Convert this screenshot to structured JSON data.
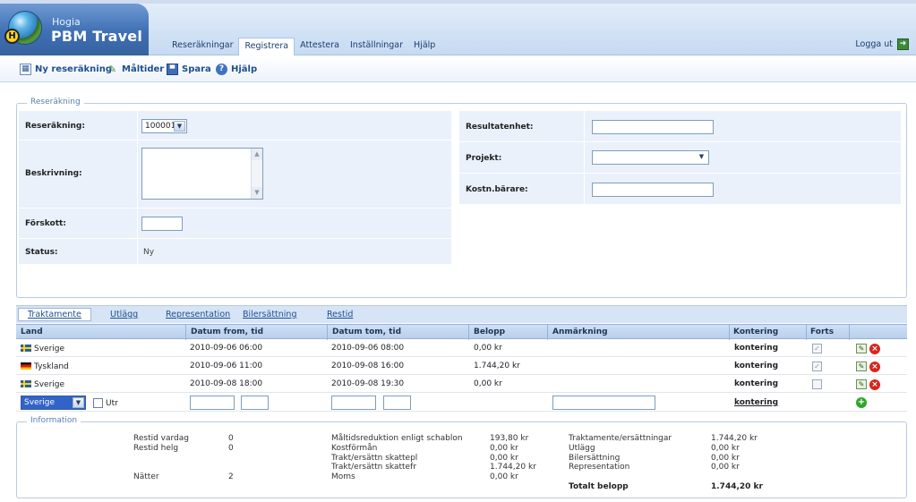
{
  "app": {
    "brand_small": "Hogia",
    "brand_big": "PBM Travel"
  },
  "nav": {
    "items": [
      "Reseräkningar",
      "Registrera",
      "Attestera",
      "Inställningar",
      "Hjälp"
    ],
    "active": "Registrera",
    "logout": "Logga ut"
  },
  "toolbar": {
    "new_report": "Ny reseräkning",
    "meals": "Måltider",
    "save": "Spara",
    "help": "Hjälp"
  },
  "report": {
    "legend": "Reseräkning",
    "report_label": "Reseräkning:",
    "report_value": "100001",
    "desc_label": "Beskrivning:",
    "advance_label": "Förskott:",
    "status_label": "Status:",
    "status_value": "Ny",
    "result_unit_label": "Resultatenhet:",
    "project_label": "Projekt:",
    "cost_bearer_label": "Kostn.bärare:"
  },
  "tabs": [
    "Traktamente",
    "Utlägg",
    "Representation",
    "Bilersättning",
    "Restid"
  ],
  "table": {
    "headers": {
      "land": "Land",
      "from": "Datum from, tid",
      "to": "Datum tom, tid",
      "amount": "Belopp",
      "note": "Anmärkning",
      "account": "Kontering",
      "cont": "Forts"
    },
    "rows": [
      {
        "country": "Sverige",
        "flag": "se",
        "from": "2010-09-06 06:00",
        "to": "2010-09-06 08:00",
        "amount": "0,00 kr",
        "account": "kontering",
        "cont": true
      },
      {
        "country": "Tyskland",
        "flag": "de",
        "from": "2010-09-06 11:00",
        "to": "2010-09-08 16:00",
        "amount": "1.744,20 kr",
        "account": "kontering",
        "cont": true
      },
      {
        "country": "Sverige",
        "flag": "se",
        "from": "2010-09-08 18:00",
        "to": "2010-09-08 19:30",
        "amount": "0,00 kr",
        "account": "kontering",
        "cont": false
      }
    ],
    "new_row": {
      "country": "Sverige",
      "utr_label": "Utr",
      "account": "kontering"
    }
  },
  "info": {
    "legend": "Information",
    "col1": [
      {
        "label": "Restid vardag",
        "value": "0"
      },
      {
        "label": "Restid helg",
        "value": "0"
      },
      {
        "label": "Nätter",
        "value": "2"
      }
    ],
    "col2": [
      {
        "label": "Måltidsreduktion enligt schablon",
        "value": "193,80 kr"
      },
      {
        "label": "Kostförmån",
        "value": "0,00 kr"
      },
      {
        "label": "Trakt/ersättn skattepl",
        "value": "0,00 kr"
      },
      {
        "label": "Trakt/ersättn skattefr",
        "value": "1.744,20 kr"
      },
      {
        "label": "Moms",
        "value": "0,00 kr"
      }
    ],
    "col3": [
      {
        "label": "Traktamente/ersättningar",
        "value": "1.744,20 kr"
      },
      {
        "label": "Utlägg",
        "value": "0,00 kr"
      },
      {
        "label": "Bilersättning",
        "value": "0,00 kr"
      },
      {
        "label": "Representation",
        "value": "0,00 kr"
      }
    ],
    "total_label": "Totalt belopp",
    "total_value": "1.744,20 kr"
  }
}
